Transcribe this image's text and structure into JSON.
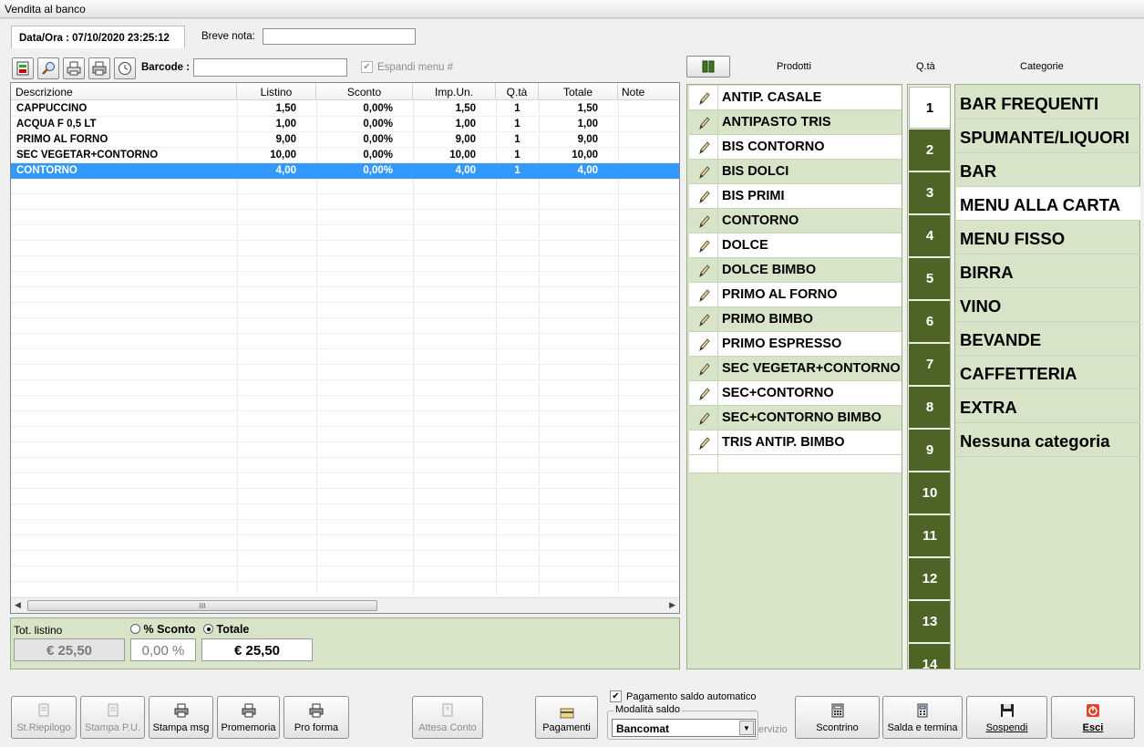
{
  "window": {
    "title": "Vendita al banco"
  },
  "header": {
    "datetime": "Data/Ora : 07/10/2020 23:25:12",
    "note_label": "Breve nota:",
    "note_value": "",
    "barcode_label": "Barcode :",
    "barcode_value": "",
    "expand_menu_label": "Espandi menu #"
  },
  "grid": {
    "columns": [
      "Descrizione",
      "Listino",
      "Sconto",
      "Imp.Un.",
      "Q.tà",
      "Totale",
      "Note"
    ],
    "rows": [
      {
        "desc": "CAPPUCCINO",
        "listino": "1,50",
        "sconto": "0,00%",
        "imp": "1,50",
        "qta": "1",
        "totale": "1,50",
        "note": ""
      },
      {
        "desc": "ACQUA F 0,5 LT",
        "listino": "1,00",
        "sconto": "0,00%",
        "imp": "1,00",
        "qta": "1",
        "totale": "1,00",
        "note": ""
      },
      {
        "desc": "PRIMO AL FORNO",
        "listino": "9,00",
        "sconto": "0,00%",
        "imp": "9,00",
        "qta": "1",
        "totale": "9,00",
        "note": ""
      },
      {
        "desc": "SEC VEGETAR+CONTORNO",
        "listino": "10,00",
        "sconto": "0,00%",
        "imp": "10,00",
        "qta": "1",
        "totale": "10,00",
        "note": ""
      },
      {
        "desc": "CONTORNO",
        "listino": "4,00",
        "sconto": "0,00%",
        "imp": "4,00",
        "qta": "1",
        "totale": "4,00",
        "note": ""
      }
    ],
    "selected_row": 4,
    "scroll_grip": "III"
  },
  "totals": {
    "tot_listino_label": "Tot. listino",
    "sconto_label": "% Sconto",
    "totale_label": "Totale",
    "tot_listino_value": "€ 25,50",
    "sconto_value": "0,00 %",
    "totale_value": "€ 25,50"
  },
  "right_header": {
    "prodotti": "Prodotti",
    "qta": "Q.tà",
    "categorie": "Categorie"
  },
  "products": [
    "ANTIP. CASALE",
    "ANTIPASTO TRIS",
    "BIS CONTORNO",
    "BIS DOLCI",
    "BIS PRIMI",
    "CONTORNO",
    "DOLCE",
    "DOLCE BIMBO",
    "PRIMO AL FORNO",
    "PRIMO BIMBO",
    "PRIMO ESPRESSO",
    "SEC VEGETAR+CONTORNO",
    "SEC+CONTORNO",
    "SEC+CONTORNO BIMBO",
    "TRIS ANTIP. BIMBO"
  ],
  "quantities": [
    "1",
    "2",
    "3",
    "4",
    "5",
    "6",
    "7",
    "8",
    "9",
    "10",
    "11",
    "12",
    "13",
    "14"
  ],
  "selected_quantity": "1",
  "categories": [
    "BAR FREQUENTI",
    "SPUMANTE/LIQUORI",
    "BAR",
    "MENU ALLA CARTA",
    "MENU FISSO",
    "BIRRA",
    "VINO",
    "BEVANDE",
    "CAFFETTERIA",
    "EXTRA",
    "Nessuna categoria"
  ],
  "selected_category": "MENU ALLA CARTA",
  "bottom": {
    "st_riepilogo": "St.Riepilogo",
    "stampa_pu": "Stampa P.U.",
    "stampa_msg": "Stampa msg",
    "promemoria": "Promemoria",
    "pro_forma": "Pro forma",
    "attesa_conto": "Attesa Conto",
    "pagamenti": "Pagamenti",
    "pagamento_auto_label": "Pagamento saldo automatico",
    "modalita_label": "Modalità saldo",
    "modalita_value": "Bancomat",
    "servizio": "ervizio",
    "scontrino": "Scontrino",
    "salda": "Salda e termina",
    "sospendi": "Sospendi",
    "esci": "Esci"
  },
  "colors": {
    "panel_green": "#d7e4c8",
    "qty_green": "#4d6426",
    "selection_blue": "#3399ff"
  }
}
